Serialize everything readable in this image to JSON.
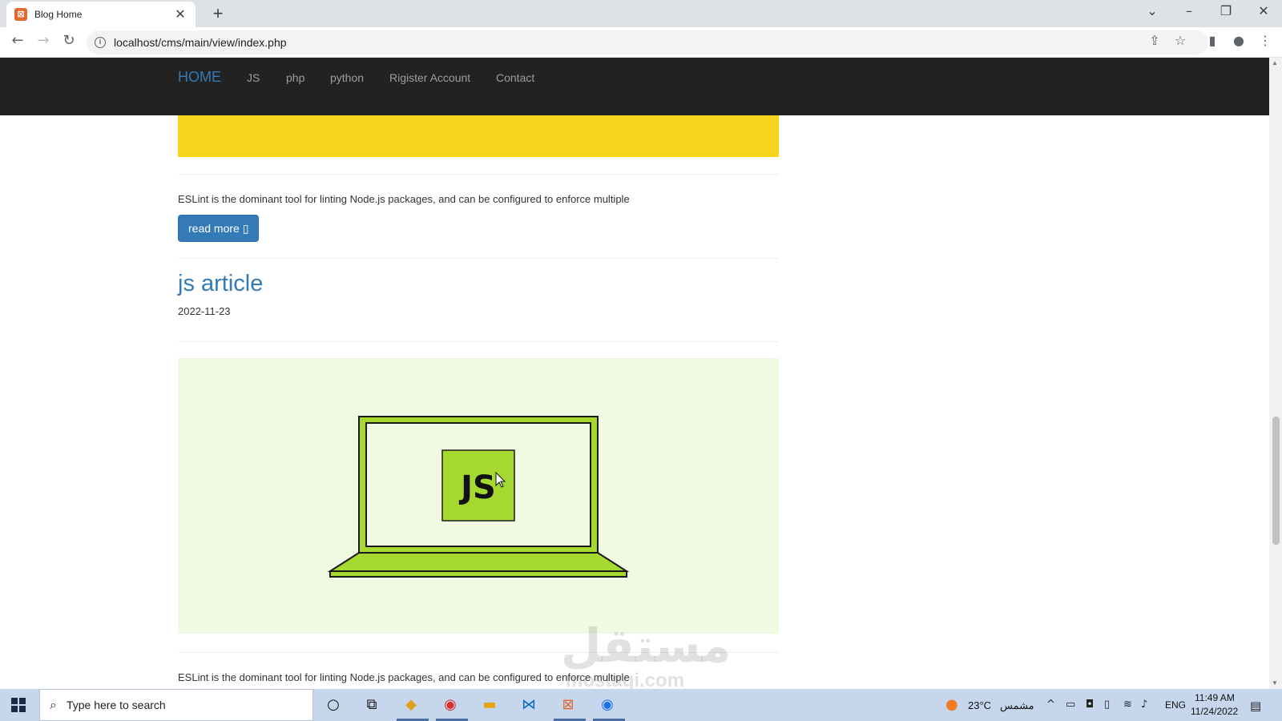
{
  "browser": {
    "tab_title": "Blog Home",
    "tab_favicon": "xampp-icon",
    "url": "localhost/cms/main/view/index.php"
  },
  "navbar": {
    "home": "HOME",
    "links": [
      "JS",
      "php",
      "python",
      "Rigister Account",
      "Contact"
    ]
  },
  "posts": {
    "first_excerpt": "ESLint is the dominant tool for linting Node.js packages, and can be configured to enforce multiple",
    "read_more": "read more ▯",
    "second_title": "js article",
    "second_date": "2022-11-23",
    "js_badge": "JS",
    "second_excerpt": "ESLint is the dominant tool for linting Node.js packages, and can be configured to enforce multiple"
  },
  "watermark": {
    "arabic": "مستقل",
    "latin": "mostaqi.com"
  },
  "taskbar": {
    "search_placeholder": "Type here to search",
    "weather_temp": "23°C",
    "weather_text": "مشمس",
    "language": "ENG",
    "time": "11:49 AM",
    "date": "11/24/2022"
  },
  "colors": {
    "navbar_bg": "#222222",
    "link_blue": "#337ab7",
    "yellow_banner": "#f7d51d",
    "js_green": "#a6d930"
  }
}
